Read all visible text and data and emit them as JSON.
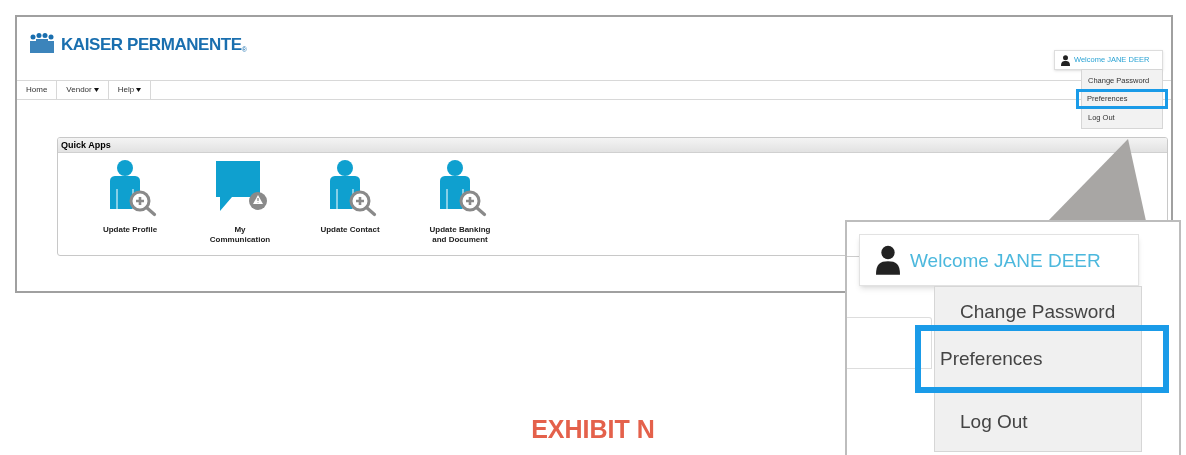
{
  "logo": {
    "text": "KAISER PERMANENTE",
    "mark": "®"
  },
  "nav": [
    {
      "label": "Home",
      "dropdown": false
    },
    {
      "label": "Vendor",
      "dropdown": true
    },
    {
      "label": "Help",
      "dropdown": true
    }
  ],
  "user_menu": {
    "greeting": "Welcome JANE DEER",
    "items": [
      {
        "label": "Change Password",
        "highlighted": false
      },
      {
        "label": "Preferences",
        "highlighted": true
      },
      {
        "label": "Log Out",
        "highlighted": false
      }
    ]
  },
  "quick_apps": {
    "title": "Quick Apps",
    "apps": [
      {
        "label": "Update Profile",
        "kind": "person"
      },
      {
        "label": "My\nCommunication",
        "kind": "chat"
      },
      {
        "label": "Update Contact",
        "kind": "person"
      },
      {
        "label": "Update Banking\nand Document",
        "kind": "person"
      }
    ]
  },
  "callout": {
    "greeting": "Welcome JANE DEER",
    "items": [
      {
        "label": "Change Password",
        "highlighted": false
      },
      {
        "label": "Preferences",
        "highlighted": true
      },
      {
        "label": "Log Out",
        "highlighted": false
      }
    ]
  },
  "caption": "EXHIBIT N"
}
